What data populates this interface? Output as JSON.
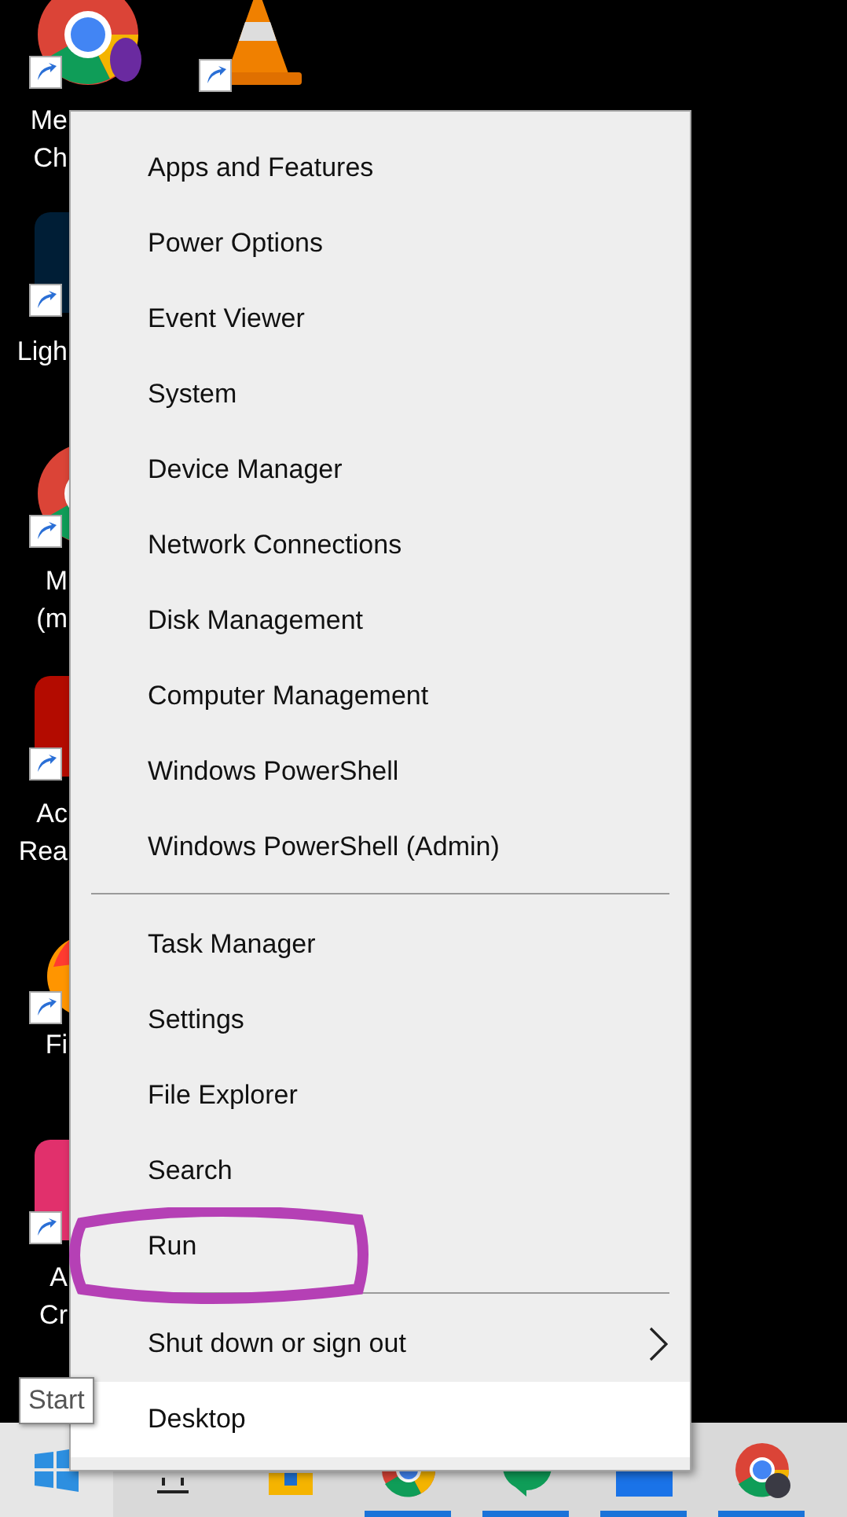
{
  "desktop_icons": [
    {
      "kind": "ring",
      "label_lines": [
        "Me",
        "Ch"
      ]
    },
    {
      "kind": "cone"
    },
    {
      "kind": "tile",
      "color": "#001e36",
      "label_lines": [
        "Ligh"
      ]
    },
    {
      "kind": "ring",
      "label_lines": [
        "M",
        "(m"
      ]
    },
    {
      "kind": "tile",
      "color": "#b30b00",
      "label_lines": [
        "Ac",
        "Rea"
      ]
    },
    {
      "kind": "flame",
      "label_lines": [
        "Fi"
      ]
    },
    {
      "kind": "tile",
      "color": "#e1306c",
      "label_lines": [
        "A",
        "Cr"
      ]
    }
  ],
  "menu": {
    "sections": [
      {
        "items": [
          {
            "label": "Apps and Features",
            "submenu": false,
            "selected": false,
            "circled": false
          },
          {
            "label": "Power Options",
            "submenu": false,
            "selected": false,
            "circled": false
          },
          {
            "label": "Event Viewer",
            "submenu": false,
            "selected": false,
            "circled": false
          },
          {
            "label": "System",
            "submenu": false,
            "selected": false,
            "circled": false
          },
          {
            "label": "Device Manager",
            "submenu": false,
            "selected": false,
            "circled": false
          },
          {
            "label": "Network Connections",
            "submenu": false,
            "selected": false,
            "circled": false
          },
          {
            "label": "Disk Management",
            "submenu": false,
            "selected": false,
            "circled": false
          },
          {
            "label": "Computer Management",
            "submenu": false,
            "selected": false,
            "circled": false
          },
          {
            "label": "Windows PowerShell",
            "submenu": false,
            "selected": false,
            "circled": false
          },
          {
            "label": "Windows PowerShell (Admin)",
            "submenu": false,
            "selected": false,
            "circled": false
          }
        ]
      },
      {
        "items": [
          {
            "label": "Task Manager",
            "submenu": false,
            "selected": false,
            "circled": false
          },
          {
            "label": "Settings",
            "submenu": false,
            "selected": false,
            "circled": false
          },
          {
            "label": "File Explorer",
            "submenu": false,
            "selected": false,
            "circled": false
          },
          {
            "label": "Search",
            "submenu": false,
            "selected": false,
            "circled": false
          },
          {
            "label": "Run",
            "submenu": false,
            "selected": false,
            "circled": true
          }
        ]
      },
      {
        "items": [
          {
            "label": "Shut down or sign out",
            "submenu": true,
            "selected": false,
            "circled": false
          },
          {
            "label": "Desktop",
            "submenu": false,
            "selected": true,
            "circled": false
          }
        ]
      }
    ]
  },
  "tooltip": {
    "text": "Start"
  },
  "taskbar": {
    "items": [
      {
        "kind": "start",
        "running": false
      },
      {
        "kind": "task-view",
        "running": false
      },
      {
        "kind": "store",
        "running": false
      },
      {
        "kind": "ring",
        "running": true
      },
      {
        "kind": "chat",
        "running": true
      },
      {
        "kind": "slack",
        "running": true
      },
      {
        "kind": "ring-avatar",
        "running": true
      }
    ]
  }
}
